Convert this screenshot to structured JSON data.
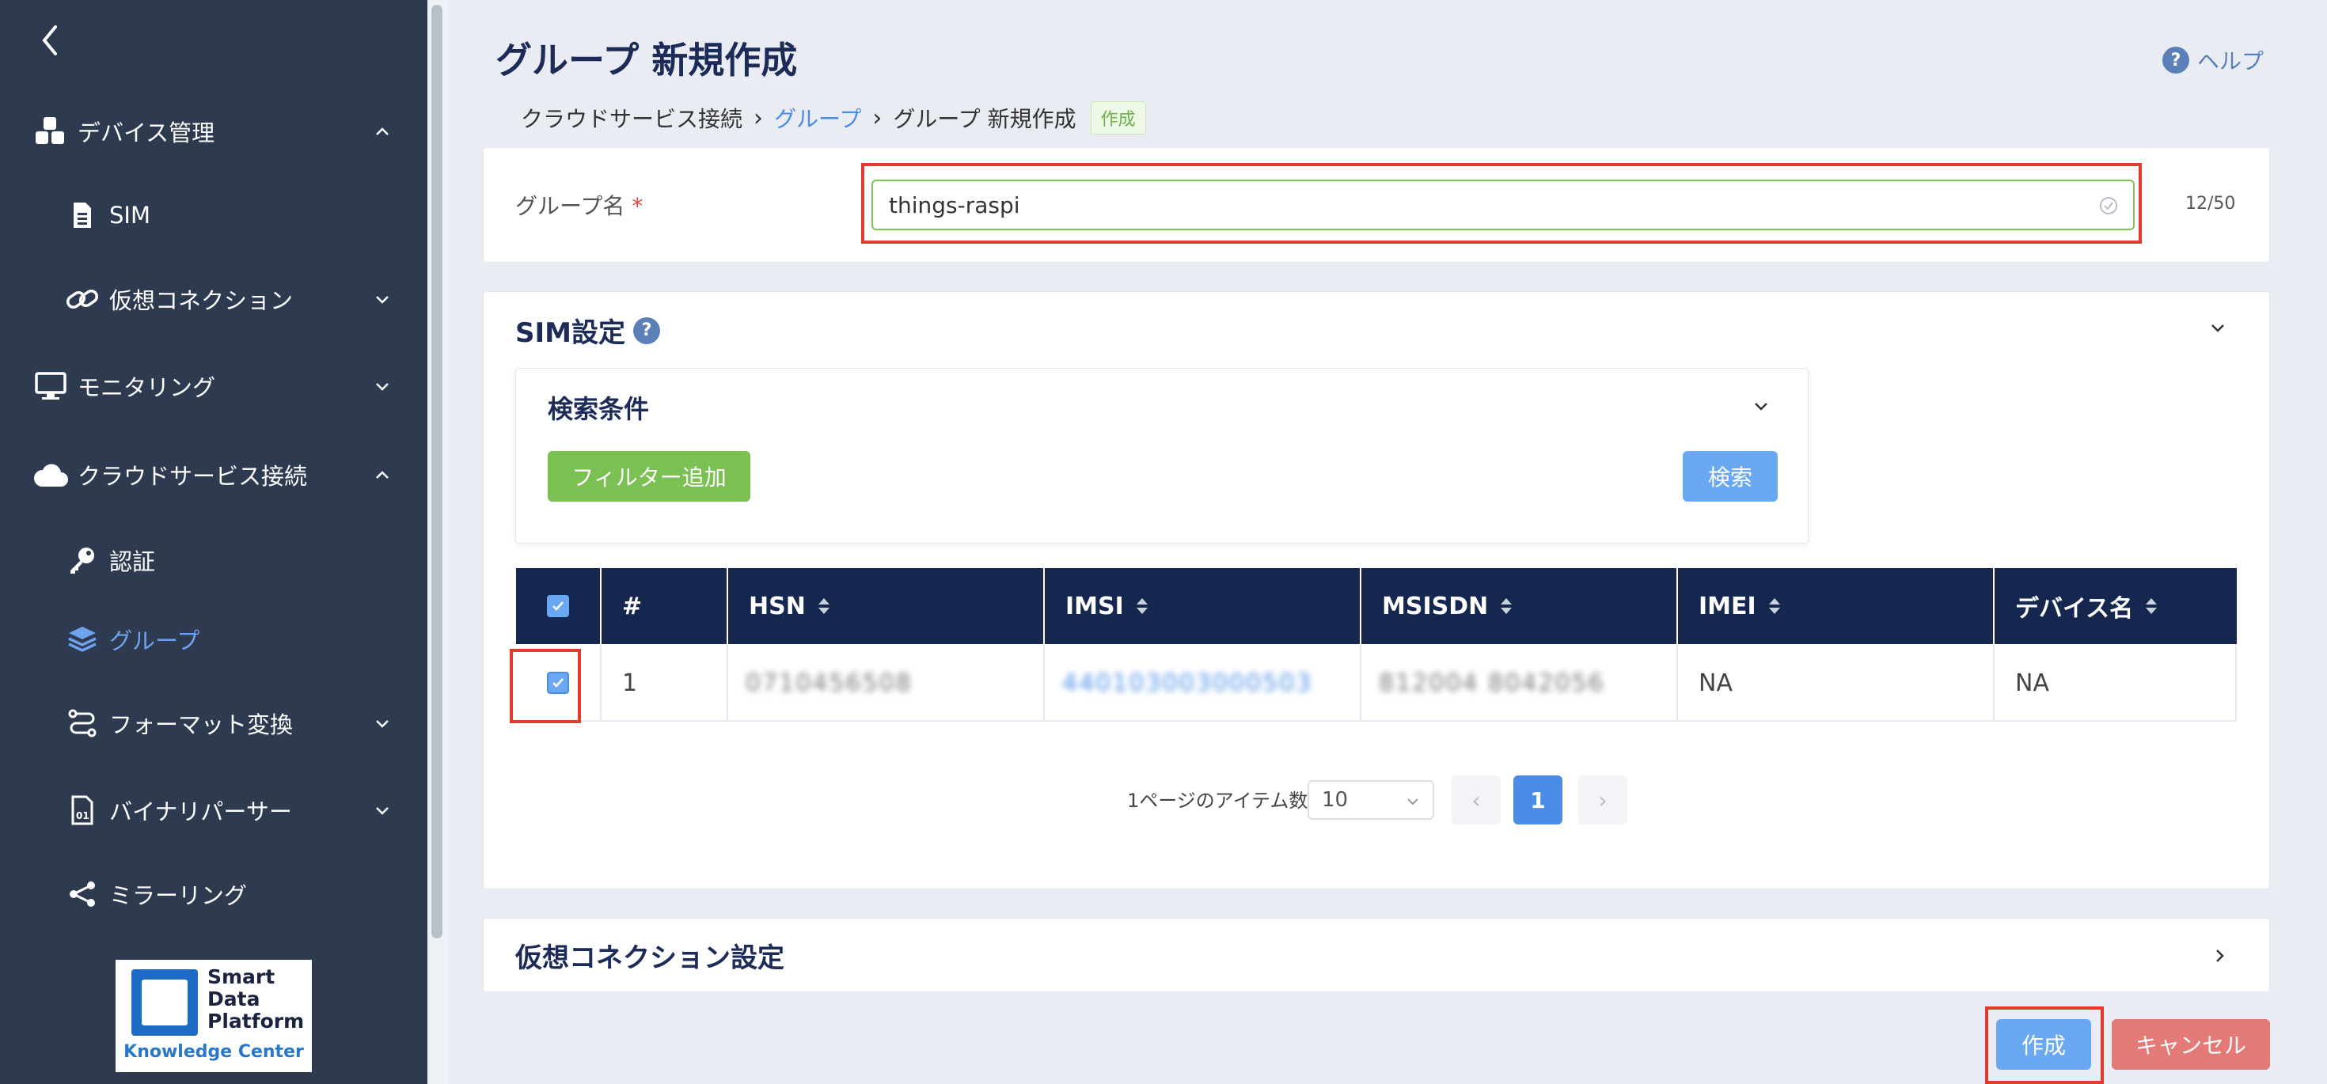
{
  "sidebar": {
    "items": [
      {
        "label": "デバイス管理",
        "icon": "cubes-icon"
      },
      {
        "label": "SIM",
        "icon": "sim-icon"
      },
      {
        "label": "仮想コネクション",
        "icon": "link-icon"
      },
      {
        "label": "モニタリング",
        "icon": "monitor-icon"
      },
      {
        "label": "クラウドサービス接続",
        "icon": "cloud-icon"
      },
      {
        "label": "認証",
        "icon": "key-icon"
      },
      {
        "label": "グループ",
        "icon": "layers-icon"
      },
      {
        "label": "フォーマット変換",
        "icon": "route-icon"
      },
      {
        "label": "バイナリパーサー",
        "icon": "binary-file-icon"
      },
      {
        "label": "ミラーリング",
        "icon": "share-icon"
      }
    ],
    "logo": {
      "line1": "Smart",
      "line2": "Data",
      "line3": "Platform",
      "sub": "Knowledge Center"
    }
  },
  "header": {
    "title": "グループ 新規作成",
    "help": "ヘルプ",
    "breadcrumb": [
      "クラウドサービス接続",
      "グループ",
      "グループ 新規作成"
    ],
    "tag": "作成"
  },
  "group_form": {
    "label": "グループ名",
    "required_mark": "*",
    "value": "things-raspi",
    "counter": "12/50"
  },
  "sim_settings": {
    "title": "SIM設定",
    "search": {
      "title": "検索条件",
      "add_filter": "フィルター追加",
      "search_button": "検索"
    },
    "table": {
      "headers": [
        "#",
        "HSN",
        "IMSI",
        "MSISDN",
        "IMEI",
        "デバイス名"
      ],
      "rows": [
        {
          "index": "1",
          "hsn": "0710456508",
          "imsi": "440103003000503",
          "msisdn": "812004 8042056",
          "imei": "NA",
          "device": "NA"
        }
      ]
    },
    "pager": {
      "label": "1ページのアイテム数",
      "page_size": "10",
      "current_page": "1"
    }
  },
  "virtual_connection": {
    "title": "仮想コネクション設定"
  },
  "actions": {
    "create": "作成",
    "cancel": "キャンセル"
  },
  "colors": {
    "sidebar": "#2e3a4f",
    "header_navy": "#15264f",
    "accent_blue": "#4b8de6",
    "green": "#7ac052",
    "danger": "#e37a77",
    "highlight_red": "#e03b2c"
  }
}
